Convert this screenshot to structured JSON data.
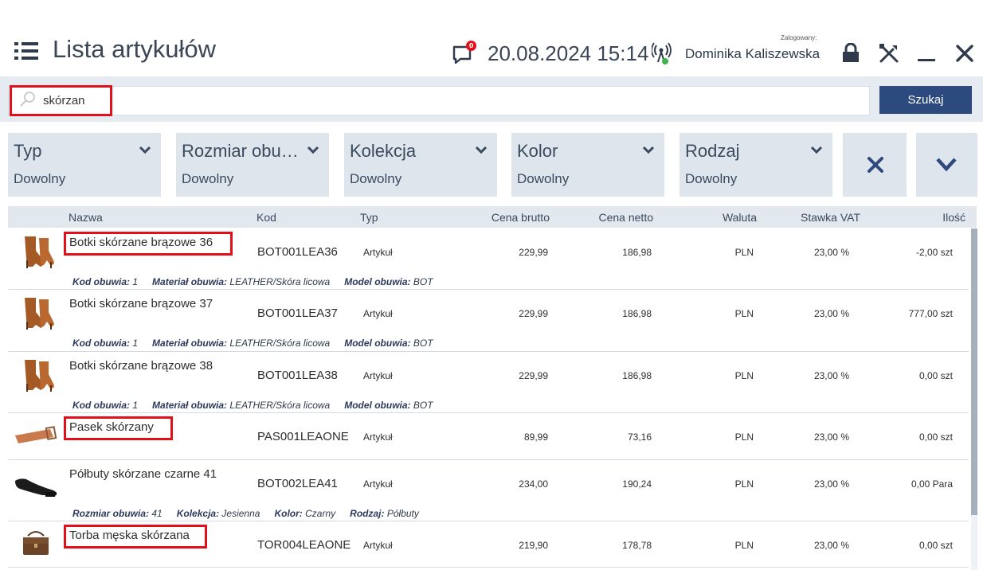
{
  "header": {
    "title": "Lista artykułów",
    "notifications_count": "0",
    "datetime": "20.08.2024 15:14",
    "logged_label": "Zalogowany:",
    "user": "Dominika Kaliszewska"
  },
  "search": {
    "value": "skórzan",
    "button": "Szukaj"
  },
  "filters": [
    {
      "label": "Typ",
      "value": "Dowolny"
    },
    {
      "label": "Rozmiar obu…",
      "value": "Dowolny"
    },
    {
      "label": "Kolekcja",
      "value": "Dowolny"
    },
    {
      "label": "Kolor",
      "value": "Dowolny"
    },
    {
      "label": "Rodzaj",
      "value": "Dowolny"
    }
  ],
  "columns": [
    "Nazwa",
    "Kod",
    "Typ",
    "Cena brutto",
    "Cena netto",
    "Waluta",
    "Stawka VAT",
    "Ilość"
  ],
  "rows": [
    {
      "name": "Botki skórzane brązowe 36",
      "code": "BOT001LEA36",
      "type": "Artykuł",
      "gross": "229,99",
      "net": "186,98",
      "currency": "PLN",
      "vat": "23,00 %",
      "qty": "-2,00 szt",
      "highlight": true,
      "thumb": "boot",
      "attrs": [
        {
          "k": "Kod obuwia:",
          "v": "1"
        },
        {
          "k": "Materiał obuwia:",
          "v": "LEATHER/Skóra licowa"
        },
        {
          "k": "Model obuwia:",
          "v": "BOT"
        }
      ]
    },
    {
      "name": "Botki skórzane brązowe 37",
      "code": "BOT001LEA37",
      "type": "Artykuł",
      "gross": "229,99",
      "net": "186,98",
      "currency": "PLN",
      "vat": "23,00 %",
      "qty": "777,00 szt",
      "highlight": false,
      "thumb": "boot",
      "attrs": [
        {
          "k": "Kod obuwia:",
          "v": "1"
        },
        {
          "k": "Materiał obuwia:",
          "v": "LEATHER/Skóra licowa"
        },
        {
          "k": "Model obuwia:",
          "v": "BOT"
        }
      ]
    },
    {
      "name": "Botki skórzane brązowe 38",
      "code": "BOT001LEA38",
      "type": "Artykuł",
      "gross": "229,99",
      "net": "186,98",
      "currency": "PLN",
      "vat": "23,00 %",
      "qty": "0,00 szt",
      "highlight": false,
      "thumb": "boot",
      "attrs": [
        {
          "k": "Kod obuwia:",
          "v": "1"
        },
        {
          "k": "Materiał obuwia:",
          "v": "LEATHER/Skóra licowa"
        },
        {
          "k": "Model obuwia:",
          "v": "BOT"
        }
      ]
    },
    {
      "name": "Pasek skórzany",
      "code": "PAS001LEAONE",
      "type": "Artykuł",
      "gross": "89,99",
      "net": "73,16",
      "currency": "PLN",
      "vat": "23,00 %",
      "qty": "0,00 szt",
      "highlight": true,
      "thumb": "belt",
      "attrs": []
    },
    {
      "name": "Półbuty skórzane czarne 41",
      "code": "BOT002LEA41",
      "type": "Artykuł",
      "gross": "234,00",
      "net": "190,24",
      "currency": "PLN",
      "vat": "23,00 %",
      "qty": "0,00 Para",
      "highlight": false,
      "thumb": "shoe",
      "attrs": [
        {
          "k": "Rozmiar obuwia:",
          "v": "41"
        },
        {
          "k": "Kolekcja:",
          "v": "Jesienna"
        },
        {
          "k": "Kolor:",
          "v": "Czarny"
        },
        {
          "k": "Rodzaj:",
          "v": "Półbuty"
        }
      ]
    },
    {
      "name": "Torba męska skórzana",
      "code": "TOR004LEAONE",
      "type": "Artykuł",
      "gross": "219,90",
      "net": "178,78",
      "currency": "PLN",
      "vat": "23,00 %",
      "qty": "0,00 szt",
      "highlight": true,
      "thumb": "bag",
      "attrs": []
    }
  ],
  "colors": {
    "accent": "#2c4a7d",
    "highlight": "#e3101a",
    "badge": "#e3101a",
    "online": "#3fb34f"
  }
}
